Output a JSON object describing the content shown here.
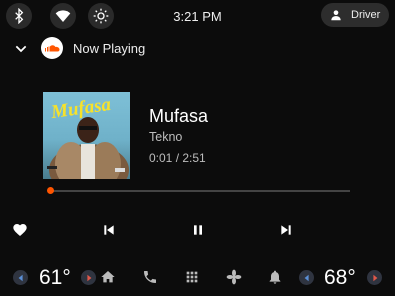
{
  "status_bar": {
    "clock": "3:21 PM",
    "profile_label": "Driver"
  },
  "header": {
    "title": "Now Playing"
  },
  "track": {
    "title": "Mufasa",
    "artist": "Tekno",
    "time": "0:01 / 2:51",
    "progress_fraction": 0.006,
    "art_text": "Mufasa"
  },
  "climate": {
    "left_temp": "61°",
    "right_temp": "68°"
  },
  "colors": {
    "accent": "#ff5500",
    "background": "#0c0c0c",
    "pill": "#2a2a2a"
  },
  "icons": {
    "status": [
      "bluetooth-icon",
      "wifi-icon",
      "brightness-icon",
      "person-icon"
    ],
    "controls": [
      "heart-icon",
      "skip-previous-icon",
      "pause-icon",
      "skip-next-icon"
    ],
    "nav": [
      "home-icon",
      "phone-icon",
      "app-grid-icon",
      "fan-icon",
      "bell-icon"
    ]
  }
}
